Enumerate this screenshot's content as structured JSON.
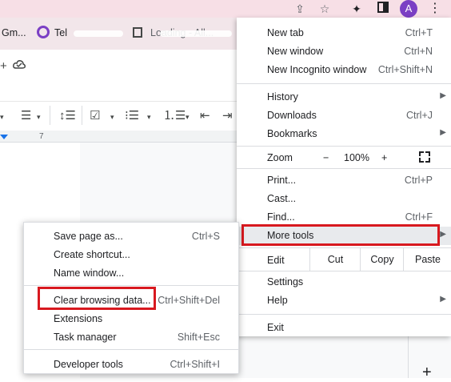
{
  "avatar_letter": "A",
  "bookmarks": [
    {
      "label": "Gm..."
    },
    {
      "label": "Tel"
    },
    {
      "label": "Loading - All..."
    }
  ],
  "ruler_number": "7",
  "chrome_menu": {
    "new_tab": {
      "label": "New tab",
      "shortcut": "Ctrl+T"
    },
    "new_window": {
      "label": "New window",
      "shortcut": "Ctrl+N"
    },
    "new_incognito": {
      "label": "New Incognito window",
      "shortcut": "Ctrl+Shift+N"
    },
    "history": {
      "label": "History"
    },
    "downloads": {
      "label": "Downloads",
      "shortcut": "Ctrl+J"
    },
    "bookmarks": {
      "label": "Bookmarks"
    },
    "zoom": {
      "label": "Zoom",
      "minus": "−",
      "value": "100%",
      "plus": "+"
    },
    "print": {
      "label": "Print...",
      "shortcut": "Ctrl+P"
    },
    "cast": {
      "label": "Cast..."
    },
    "find": {
      "label": "Find...",
      "shortcut": "Ctrl+F"
    },
    "more_tools": {
      "label": "More tools"
    },
    "edit": {
      "label": "Edit",
      "cut": "Cut",
      "copy": "Copy",
      "paste": "Paste"
    },
    "settings": {
      "label": "Settings"
    },
    "help": {
      "label": "Help"
    },
    "exit": {
      "label": "Exit"
    }
  },
  "more_tools_menu": {
    "save_page": {
      "label": "Save page as...",
      "shortcut": "Ctrl+S"
    },
    "create_shortcut": {
      "label": "Create shortcut..."
    },
    "name_window": {
      "label": "Name window..."
    },
    "clear_browsing": {
      "label": "Clear browsing data...",
      "shortcut": "Ctrl+Shift+Del"
    },
    "extensions": {
      "label": "Extensions"
    },
    "task_manager": {
      "label": "Task manager",
      "shortcut": "Shift+Esc"
    },
    "developer_tools": {
      "label": "Developer tools",
      "shortcut": "Ctrl+Shift+I"
    }
  },
  "highlight_color": "#d8191f",
  "accent_color": "#7b3fc4",
  "icons": [
    "share-icon",
    "star-icon",
    "extensions-puzzle-icon",
    "side-panel-icon",
    "kebab-menu-icon",
    "cloud-check-icon",
    "fullscreen-icon",
    "submenu-arrow-icon",
    "plus-icon"
  ]
}
